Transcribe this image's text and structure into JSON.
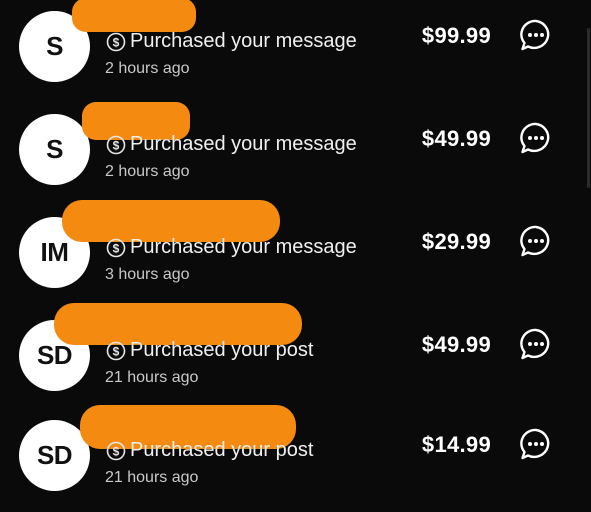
{
  "purchases": [
    {
      "initials": "S",
      "activity": "Purchased your message",
      "time": "2 hours ago",
      "price": "$99.99"
    },
    {
      "initials": "S",
      "activity": "Purchased your message",
      "time": "2 hours ago",
      "price": "$49.99"
    },
    {
      "initials": "IM",
      "activity": "Purchased your message",
      "time": "3 hours ago",
      "price": "$29.99"
    },
    {
      "initials": "SD",
      "activity": "Purchased your post",
      "time": "21 hours ago",
      "price": "$49.99"
    },
    {
      "initials": "SD",
      "activity": "Purchased your post",
      "time": "21 hours ago",
      "price": "$14.99"
    }
  ],
  "icons": {
    "activity": "dollar-circle-icon",
    "action": "chat-bubble-icon"
  },
  "colors": {
    "background": "#0a0a0b",
    "redaction": "#f58a10",
    "avatar_bg": "#ffffff"
  }
}
